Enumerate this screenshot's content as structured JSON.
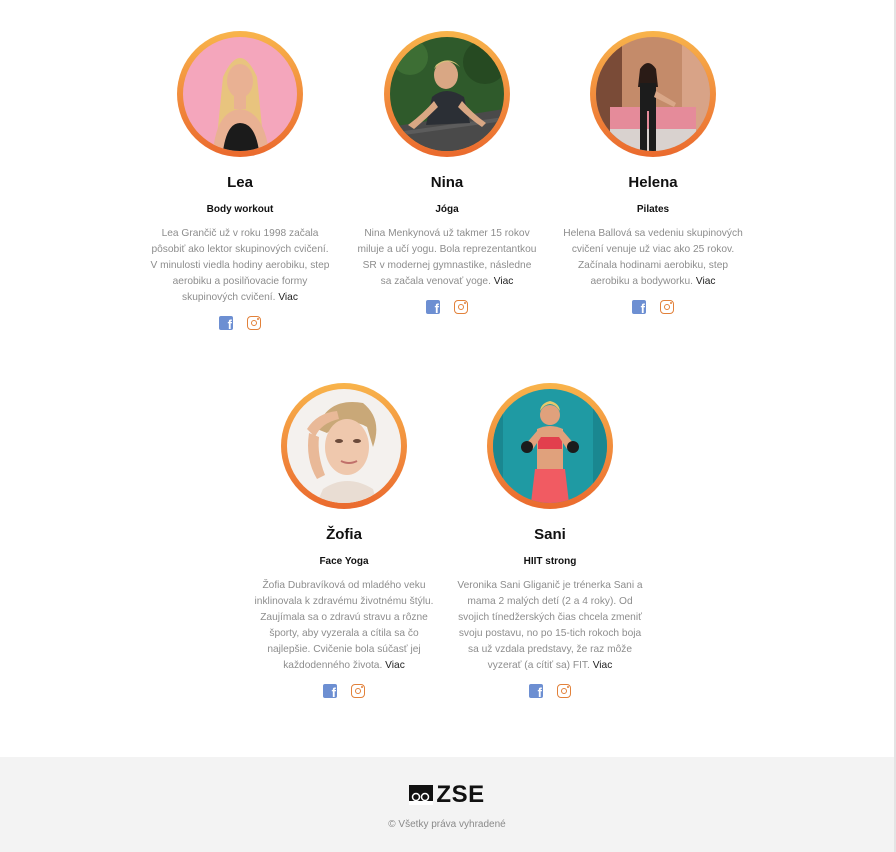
{
  "trainers": [
    {
      "name": "Lea",
      "class": "Body workout",
      "bio": "Lea Grančič už v roku 1998 začala pôsobiť ako lektor skupinových cvičení. V minulosti viedla hodiny aerobiku, step aerobiku a posilňovacie formy skupinových cvičení.",
      "more": "Viac",
      "photo_colors": {
        "bg": "#f4a6bc",
        "hair": "#e8c47e",
        "skin": "#e9b193",
        "top": "#1b1b1b"
      }
    },
    {
      "name": "Nina",
      "class": "Jóga",
      "bio": "Nina Menkynová už takmer 15 rokov miluje a učí yogu. Bola reprezentantkou SR v modernej gymnastike, následne sa začala venovať yoge.",
      "more": "Viac",
      "photo_colors": {
        "bg": "#2f5a2b",
        "hair": "#d8c27a",
        "skin": "#d9a784",
        "top": "#2b2f35"
      }
    },
    {
      "name": "Helena",
      "class": "Pilates",
      "bio": "Helena Ballová sa vedeniu skupinových cvičení venuje už viac ako 25 rokov. Začínala hodinami aerobiku, step aerobiku a bodyworku.",
      "more": "Viac",
      "photo_colors": {
        "bg": "#c48b6a",
        "hair": "#2a1b16",
        "skin": "#d9a788",
        "top": "#1c1c1c"
      }
    },
    {
      "name": "Žofia",
      "class": "Face Yoga",
      "bio": "Žofia Dubravíková od mladého veku inklinovala k zdravému životnému štýlu. Zaujímala sa o zdravú stravu a rôzne športy, aby vyzerala a cítila sa čo najlepšie. Cvičenie bola súčasť jej každodenného života.",
      "more": "Viac",
      "photo_colors": {
        "bg": "#f4f1ee",
        "hair": "#c9a878",
        "skin": "#efc8ad",
        "top": "#e9ddd3"
      }
    },
    {
      "name": "Sani",
      "class": "HIIT strong",
      "bio": "Veronika Sani Gliganič je trénerka Sani a mama 2 malých detí (2 a 4 roky). Od svojich tínedžerských čias chcela zmeniť svoju postavu, no po 15-tich rokoch boja sa už vzdala predstavy, že raz môže vyzerať (a cítiť sa) FIT.",
      "more": "Viac",
      "photo_colors": {
        "bg": "#1f9aa3",
        "hair": "#e8c86a",
        "skin": "#e0a17c",
        "top": "#e23f4d"
      }
    }
  ],
  "footer": {
    "logo_text": "ZSE",
    "copyright": "© Všetky práva vyhradené"
  },
  "icons": {
    "facebook": "facebook-icon",
    "instagram": "instagram-icon"
  },
  "colors": {
    "ring_top": "#f8b44b",
    "ring_bottom": "#ea6a2e",
    "facebook": "#6d8fd2",
    "instagram": "#e2813a"
  }
}
